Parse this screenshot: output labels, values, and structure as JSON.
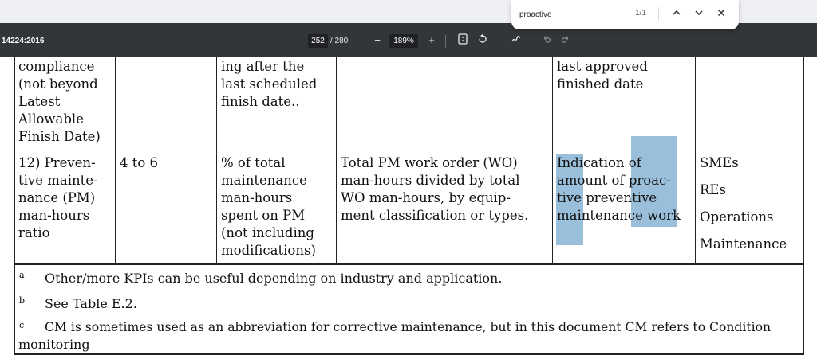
{
  "find_bar": {
    "query": "proactive",
    "count": "1/1",
    "prev_icon": "chevron-up-icon",
    "next_icon": "chevron-down-icon",
    "close_icon": "close-icon"
  },
  "toolbar": {
    "doc_title": "14224:2016",
    "page_current": "252",
    "page_total": "/ 280",
    "zoom_out": "−",
    "zoom_level": "189%",
    "zoom_in": "+",
    "fit_icon": "fit-page-icon",
    "rotate_icon": "rotate-icon",
    "annotate_icon": "annotate-icon",
    "undo_icon": "undo-icon",
    "redo_icon": "redo-icon"
  },
  "table": {
    "row_prev": {
      "col1": "compliance\n(not beyond\nLatest\nAllowable\nFinish Date)",
      "col3": "ing after the\nlast scheduled\nfinish date..",
      "col5": "last approved\nfinished date"
    },
    "row_12": {
      "kpi": "12) Preven-\ntive mainte-\nnance (PM)\nman-hours\nratio",
      "range": "4 to 6",
      "definition": "% of total\nmaintenance\nman-hours\nspent on PM\n(not including\nmodifications)",
      "formula": "Total PM work order (WO)\nman-hours divided by total\nWO man-hours, by equip-\nment classification or types.",
      "purpose": "Indication of\namount of proac-\ntive preventive\nmaintenance work",
      "users": [
        "SMEs",
        "REs",
        "Operations",
        "Maintenance"
      ]
    }
  },
  "footnotes": [
    {
      "mark": "a",
      "text": "Other/more KPIs can be useful depending on industry and application."
    },
    {
      "mark": "b",
      "text": "See Table E.2."
    },
    {
      "mark": "c",
      "text": "CM is sometimes used as an abbreviation for corrective maintenance, but in this document CM refers to Condition",
      "cont": "monitoring"
    }
  ],
  "colors": {
    "toolbar_bg": "#323639",
    "highlight": "#8db8d6",
    "find_bar_bg": "#ffffff"
  }
}
